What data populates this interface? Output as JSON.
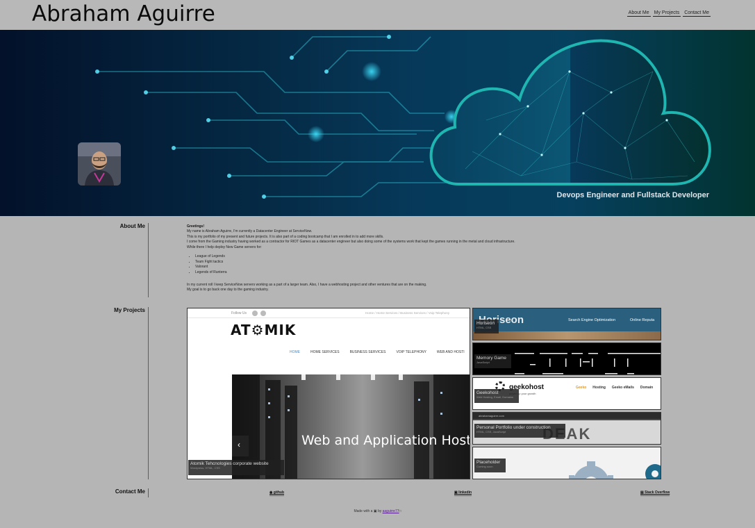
{
  "header": {
    "title": "Abraham Aguirre",
    "nav": [
      "About Me",
      "My Projects",
      "Contact Me"
    ]
  },
  "hero": {
    "tagline": "Devops Engineer and Fullstack Developer"
  },
  "about": {
    "label": "About Me",
    "greeting": "Greetings!",
    "lines": [
      "My name is Abraham Aguirre, I'm currently a Datacenter Engineer at ServiceNow.",
      "This is my portfolio of my present and future projects. It is also part of a coding bootcamp that I am enrolled in to add more skills.",
      "I come from the Gaming industry having worked as a contractor for RIOT Games as a datacenter engineer but also doing some of the systems work that kept the games running in the metal and cloud infrastructure.",
      "While there I help deploy New Game servers for:"
    ],
    "games": [
      "League of Legends",
      "Team Fight tactics",
      "Valorant",
      "Legends of Runterra"
    ],
    "closing": [
      "In my current roll I keep ServiceNow servers working as a part of a larger team. Also, I have a webhosting project and other ventures that are on the making.",
      "My goal is to go back one day to the gaming industry."
    ]
  },
  "projects": {
    "label": "My Projects",
    "main": {
      "title": "Atomik Tehcnologies corporate website",
      "subtitle": "Wordpress, HTML, CSS",
      "site": {
        "follow": "Follow Us",
        "logo": "AT⚙MIK",
        "crumbs": [
          "Home",
          "/",
          "Home Services",
          "/",
          "Business Services",
          "/",
          "Voip Telephony"
        ],
        "menu": [
          "HOME",
          "HOME SERVICES",
          "BUSINESS SERVICES",
          "VOIP TELEPHONY",
          "WEB AND HOSTI"
        ],
        "banner": "Web and Application Hosti",
        "arrow": "‹"
      }
    },
    "side": [
      {
        "title": "Horiseon",
        "subtitle": "HTML, CSS",
        "shot": {
          "logo": "Horiseon",
          "links": [
            "Search Engine Optimization",
            "Online Reputa"
          ]
        }
      },
      {
        "title": "Memory Game",
        "subtitle": "JavaScript",
        "shot": {}
      },
      {
        "title": "Geekohost",
        "subtitle": "Web Hosting, Email, Domains",
        "shot": {
          "logo": "geekohost",
          "tag": "power up your growth",
          "links": [
            "Geeko",
            "Hosting",
            "Geeko eMails",
            "Domain"
          ]
        }
      },
      {
        "title": "Personal Portfolio under construction",
        "subtitle": "HTML, CSS, JavaScript",
        "shot": {
          "bar": "abrahamaguirre.com",
          "big": "DEAK"
        }
      },
      {
        "title": "Placeholder",
        "subtitle": "Coming soon",
        "shot": {}
      }
    ]
  },
  "contact": {
    "label": "Contact Me",
    "links": [
      "github",
      "linkedin",
      "Stack Overflow"
    ]
  },
  "footer": {
    "pre": "Made with a",
    "mid": "by",
    "author": "aaguirre77"
  },
  "colors": {
    "accent_line": "#1f8a1f",
    "hero_cyan": "#1fb5b0",
    "background": "#b5b5b5"
  }
}
